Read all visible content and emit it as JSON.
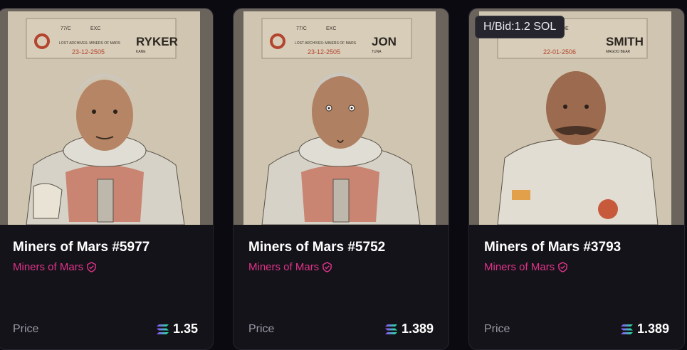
{
  "cards": [
    {
      "title": "Miners of Mars #5977",
      "collection": "Miners of Mars",
      "price_label": "Price",
      "price": "1.35",
      "art": {
        "rate": "77/C",
        "occupation": "EXC",
        "archive": "LOST ARCHIVES: MINERS OF MARS",
        "date": "23-12-2505",
        "surname": "RYKER",
        "firstname": "KANE"
      }
    },
    {
      "title": "Miners of Mars #5752",
      "collection": "Miners of Mars",
      "price_label": "Price",
      "price": "1.389",
      "art": {
        "rate": "77/C",
        "occupation": "EXC",
        "archive": "LOST ARCHIVES: MINERS OF MARS",
        "date": "23-12-2505",
        "surname": "JON",
        "firstname": "TUNA"
      }
    },
    {
      "title": "Miners of Mars #3793",
      "collection": "Miners of Mars",
      "price_label": "Price",
      "price": "1.389",
      "art": {
        "occupation": "DE",
        "date": "22-01-2506",
        "surname": "SMITH",
        "firstname": "MAGOO BEAR"
      }
    }
  ],
  "tooltip": "H/Bid:1.2 SOL",
  "icons": {
    "verified": "verified-shield-icon",
    "currency": "solana-icon"
  },
  "colors": {
    "accent": "#e0338a",
    "background": "#0b0a10",
    "card": "#141319"
  }
}
